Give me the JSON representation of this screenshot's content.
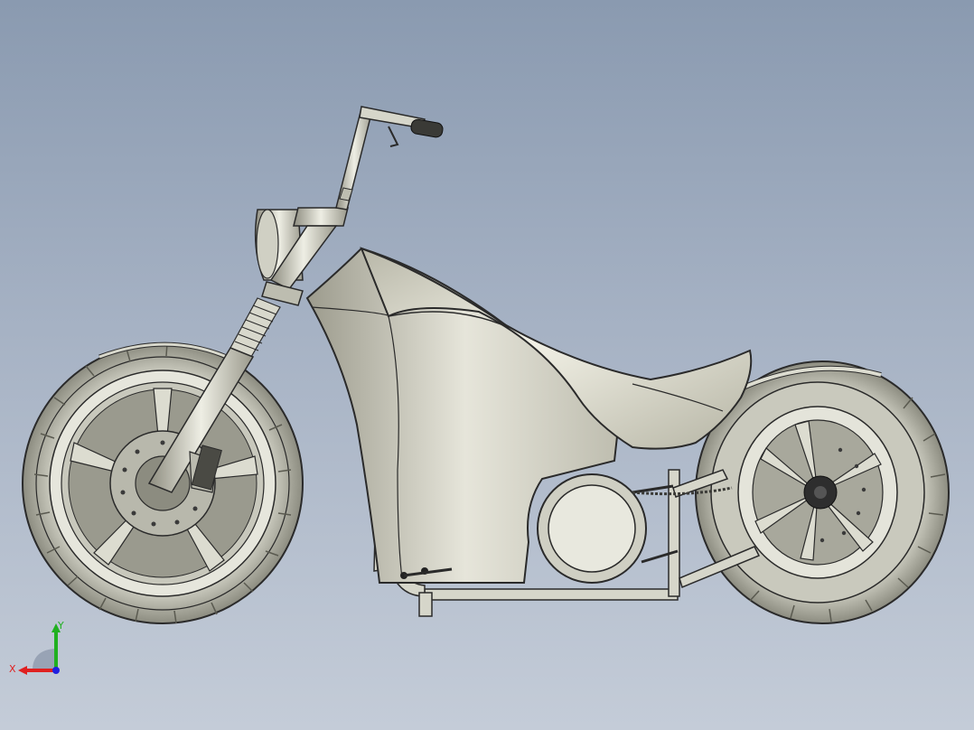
{
  "viewport": {
    "background_top": "#8a9ab0",
    "background_bottom": "#c4ccd8"
  },
  "model": {
    "name_icon": "motorcycle-model",
    "body_color": "#c9c8bc",
    "edge_color": "#2a2a2a"
  },
  "triad": {
    "x_label": "X",
    "y_label": "Y",
    "x_color": "#e02020",
    "y_color": "#20b020",
    "z_color": "#2020e0"
  }
}
